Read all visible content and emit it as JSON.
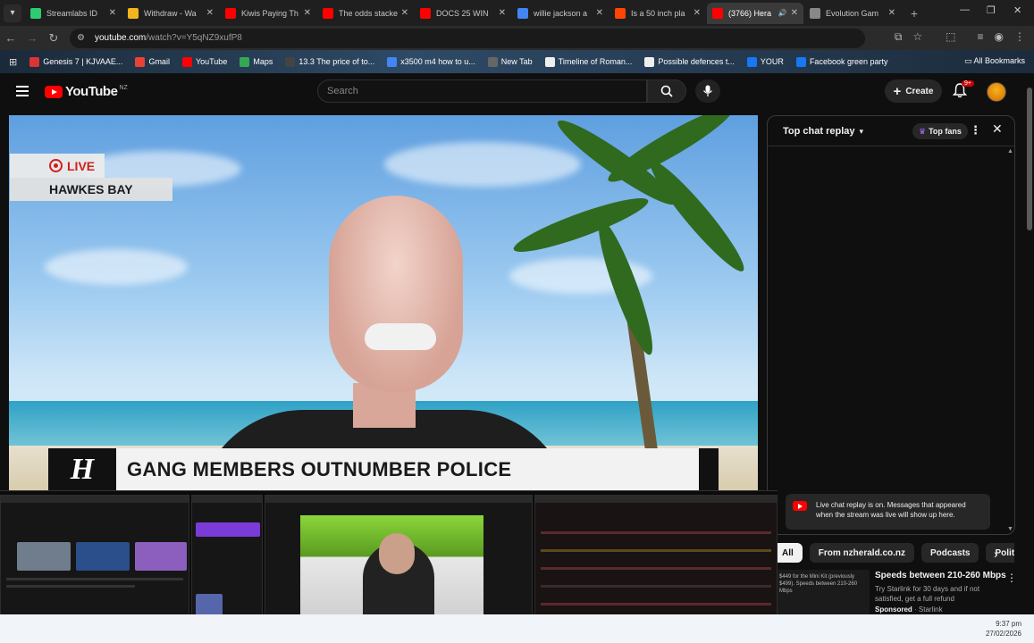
{
  "browser": {
    "tabs": [
      {
        "title": "Streamlabs ID",
        "color": "#2ecc71",
        "active": false
      },
      {
        "title": "Withdraw - Wa",
        "color": "#f3b51b",
        "active": false
      },
      {
        "title": "Kiwis Paying Th",
        "color": "#ff0000",
        "active": false
      },
      {
        "title": "The odds stacke",
        "color": "#ff0000",
        "active": false
      },
      {
        "title": "DOCS 25 WIN",
        "color": "#ff0000",
        "active": false
      },
      {
        "title": "willie jackson a",
        "color": "#4285f4",
        "active": false
      },
      {
        "title": "Is a 50 inch pla",
        "color": "#ff4500",
        "active": false
      },
      {
        "title": "(3766) Hera",
        "color": "#ff0000",
        "active": true
      },
      {
        "title": "Evolution Gam",
        "color": "#888888",
        "active": false
      }
    ],
    "url_domain": "youtube.com",
    "url_path": "/watch?v=Y5qNZ9xufP8",
    "bookmarks": [
      {
        "label": "Genesis 7 | KJVAAE...",
        "color": "#d33"
      },
      {
        "label": "Gmail",
        "color": "#ea4335"
      },
      {
        "label": "YouTube",
        "color": "#ff0000"
      },
      {
        "label": "Maps",
        "color": "#34a853"
      },
      {
        "label": "13.3 The price of to...",
        "color": "#444"
      },
      {
        "label": "x3500 m4 how to u...",
        "color": "#4285f4"
      },
      {
        "label": "New Tab",
        "color": "#666"
      },
      {
        "label": "Timeline of Roman...",
        "color": "#eee"
      },
      {
        "label": "Possible defences t...",
        "color": "#eee"
      },
      {
        "label": "YOUR",
        "color": "#1877f2"
      },
      {
        "label": "Facebook green party",
        "color": "#1877f2"
      }
    ],
    "all_bookmarks": "All Bookmarks"
  },
  "youtube": {
    "wordmark": "YouTube",
    "country": "NZ",
    "search_placeholder": "Search",
    "create_label": "Create",
    "notif_badge": "9+"
  },
  "video": {
    "live_label": "LIVE",
    "location": "HAWKES BAY",
    "herald_mark": "H",
    "headline": "GANG MEMBERS OUTNUMBER POLICE"
  },
  "chat": {
    "title": "Top chat replay",
    "top_fans": "Top fans",
    "notice": "Live chat replay is on. Messages that appeared when the stream was live will show up here."
  },
  "chips": [
    "All",
    "From nzherald.co.nz",
    "Podcasts",
    "Politi"
  ],
  "ad": {
    "thumb_text": "$449 for the Mini Kit (previously $499). Speeds between 210-260 Mbps",
    "title": "Speeds between 210-260 Mbps",
    "body": "Try Starlink for 30 days and if not satisfied, get a full refund",
    "sponsored": "Sponsored",
    "advertiser": "· Starlink"
  },
  "taskbar": {
    "time": "9:37 pm",
    "date": "27/02/2026"
  },
  "colors": {
    "accent_red": "#ff0000",
    "live_red": "#d0201a",
    "chat_bg": "#0f0f0f"
  }
}
